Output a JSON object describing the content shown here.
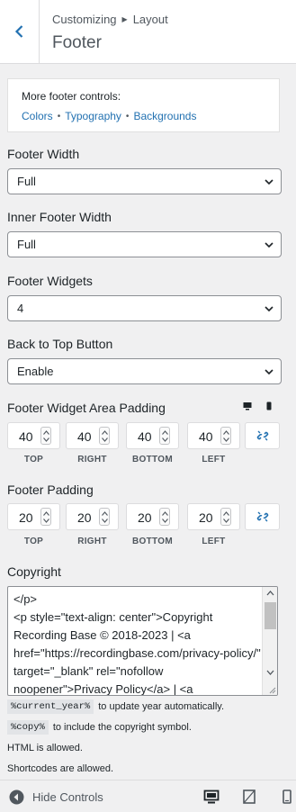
{
  "header": {
    "breadcrumb": [
      "Customizing",
      "Layout"
    ],
    "title": "Footer"
  },
  "more_controls": {
    "title": "More footer controls:",
    "links": [
      "Colors",
      "Typography",
      "Backgrounds"
    ]
  },
  "settings": {
    "footer_width": {
      "label": "Footer Width",
      "value": "Full"
    },
    "inner_footer_width": {
      "label": "Inner Footer Width",
      "value": "Full"
    },
    "footer_widgets": {
      "label": "Footer Widgets",
      "value": "4"
    },
    "back_to_top": {
      "label": "Back to Top Button",
      "value": "Enable"
    }
  },
  "widget_area_padding": {
    "label": "Footer Widget Area Padding",
    "fields": [
      {
        "value": "40",
        "caption": "TOP"
      },
      {
        "value": "40",
        "caption": "RIGHT"
      },
      {
        "value": "40",
        "caption": "BOTTOM"
      },
      {
        "value": "40",
        "caption": "LEFT"
      }
    ]
  },
  "footer_padding": {
    "label": "Footer Padding",
    "fields": [
      {
        "value": "20",
        "caption": "TOP"
      },
      {
        "value": "20",
        "caption": "RIGHT"
      },
      {
        "value": "20",
        "caption": "BOTTOM"
      },
      {
        "value": "20",
        "caption": "LEFT"
      }
    ]
  },
  "copyright": {
    "label": "Copyright",
    "text": "</p>\n<p style=\"text-align: center\">Copyright Recording Base © 2018-2023 | <a href=\"https://recordingbase.com/privacy-policy/\" target=\"_blank\" rel=\"nofollow noopener\">Privacy Policy</a> | <a",
    "hint_year_code": "%current_year%",
    "hint_year_text": "to update year automatically.",
    "hint_copy_code": "%copy%",
    "hint_copy_text": "to include the copyright symbol.",
    "note_html": "HTML is allowed.",
    "note_shortcodes": "Shortcodes are allowed."
  },
  "footer_bar": {
    "hide_controls": "Hide Controls"
  },
  "colors": {
    "accent": "#2271b1",
    "text": "#1d2327",
    "muted": "#50575e",
    "background": "#f0f0f1"
  }
}
